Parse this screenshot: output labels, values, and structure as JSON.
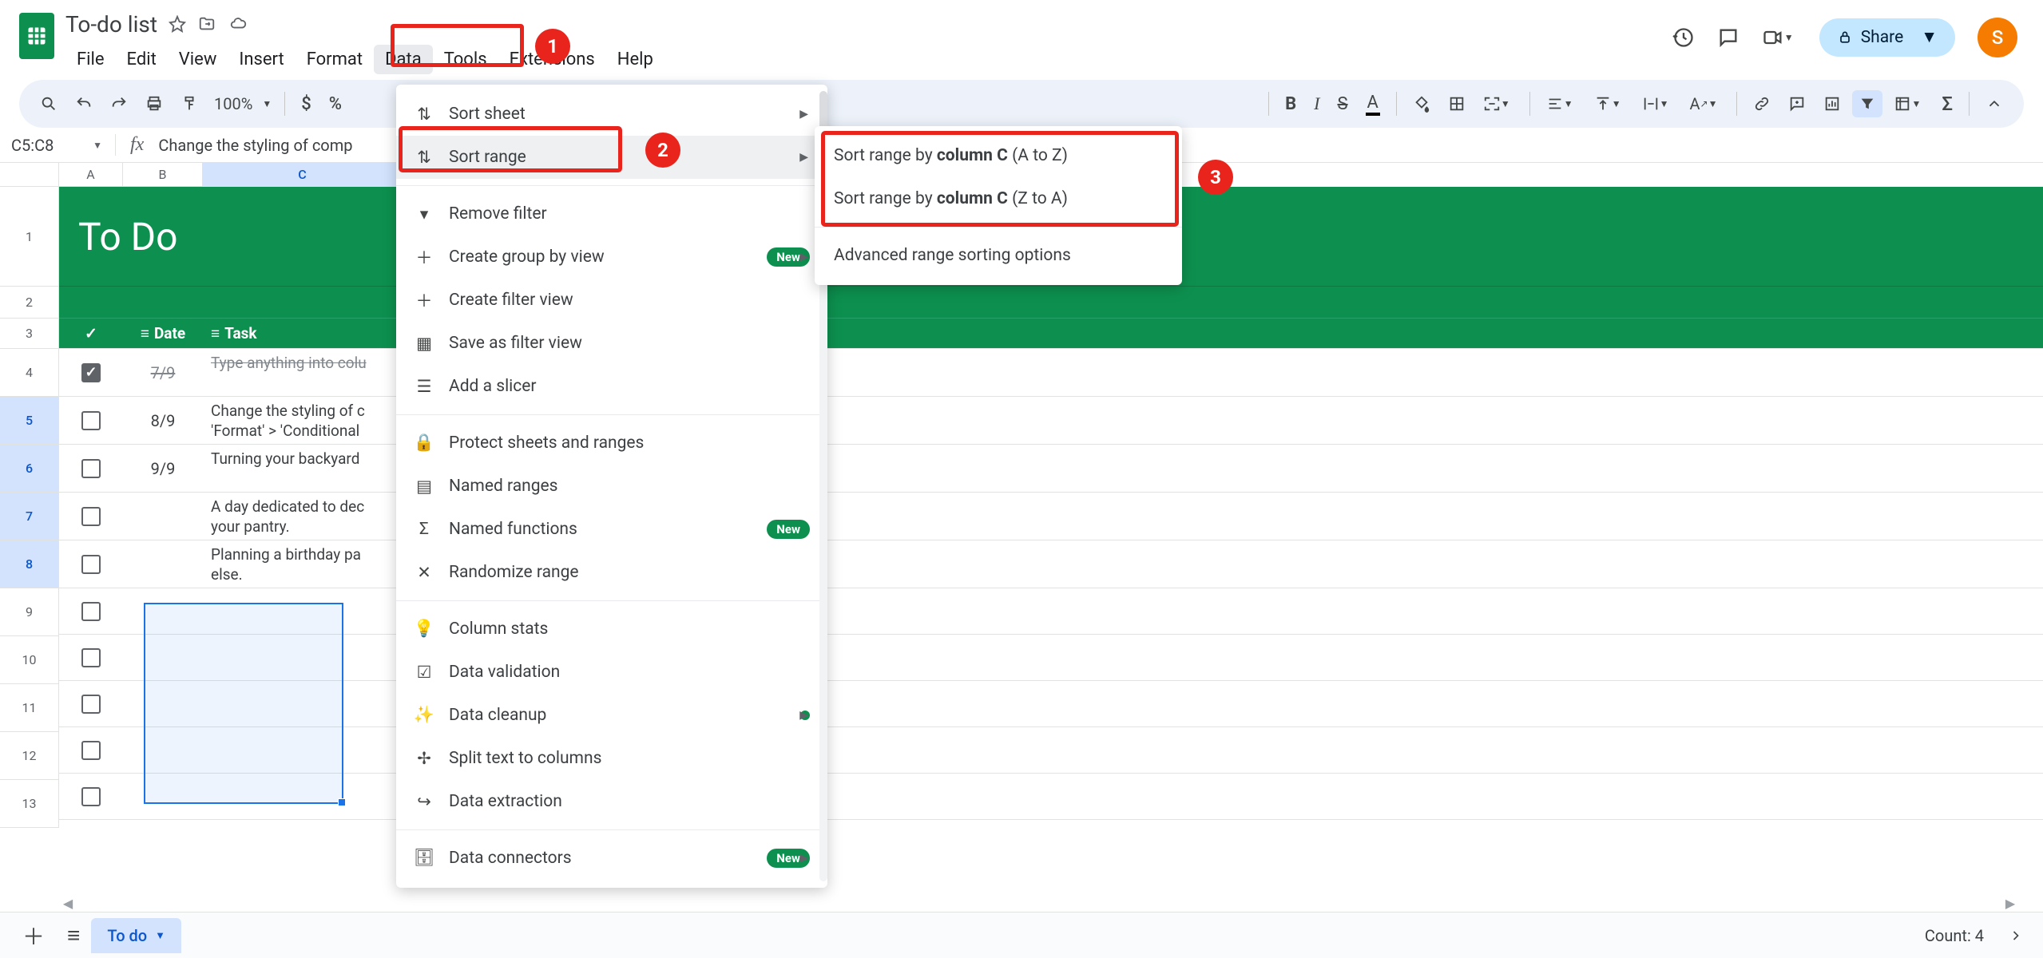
{
  "document": {
    "title": "To-do list",
    "star_tooltip": "Star",
    "cloud_tooltip": "See document status"
  },
  "menubar": {
    "file": "File",
    "edit": "Edit",
    "view": "View",
    "insert": "Insert",
    "format": "Format",
    "data": "Data",
    "tools": "Tools",
    "extensions": "Extensions",
    "help": "Help"
  },
  "title_right": {
    "share": "Share",
    "avatar_initial": "S"
  },
  "toolbar": {
    "zoom": "100%",
    "currency": "$",
    "percent": "%"
  },
  "fxbar": {
    "namebox": "C5:C8",
    "formula_preview": "Change the styling of comp"
  },
  "columns": {
    "a": "A",
    "b": "B",
    "c": "C"
  },
  "sheet": {
    "title": "To Do",
    "hdr_date": "Date",
    "hdr_task": "Task",
    "rows": [
      {
        "n": "1"
      },
      {
        "n": "2"
      },
      {
        "n": "3"
      },
      {
        "n": "4",
        "date": "7/9",
        "task": "Type anything into colu",
        "done": true
      },
      {
        "n": "5",
        "date": "8/9",
        "task": "Change the styling of c 'Format' > 'Conditional "
      },
      {
        "n": "6",
        "date": "9/9",
        "task": "Turning your backyard "
      },
      {
        "n": "7",
        "date": "",
        "task": "A day dedicated to dec your pantry."
      },
      {
        "n": "8",
        "date": "",
        "task": "Planning a birthday pa else."
      },
      {
        "n": "9"
      },
      {
        "n": "10"
      },
      {
        "n": "11"
      },
      {
        "n": "12"
      },
      {
        "n": "13"
      }
    ]
  },
  "data_menu": {
    "sort_sheet": "Sort sheet",
    "sort_range": "Sort range",
    "remove_filter": "Remove filter",
    "create_group": "Create group by view",
    "create_filter_view": "Create filter view",
    "save_filter_view": "Save as filter view",
    "add_slicer": "Add a slicer",
    "protect": "Protect sheets and ranges",
    "named_ranges": "Named ranges",
    "named_functions": "Named functions",
    "randomize": "Randomize range",
    "column_stats": "Column stats",
    "validation": "Data validation",
    "cleanup": "Data cleanup",
    "split": "Split text to columns",
    "extraction": "Data extraction",
    "connectors": "Data connectors",
    "badge_new": "New"
  },
  "sort_submenu": {
    "az_prefix": "Sort range by ",
    "az_col": "column C",
    "az_suffix": " (A to Z)",
    "za_prefix": "Sort range by ",
    "za_col": "column C",
    "za_suffix": " (Z to A)",
    "advanced": "Advanced range sorting options"
  },
  "tabbar": {
    "sheet_name": "To do",
    "count_label": "Count: 4"
  },
  "annotations": {
    "one": "1",
    "two": "2",
    "three": "3"
  }
}
